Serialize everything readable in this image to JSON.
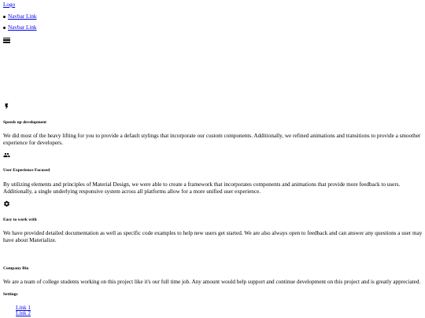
{
  "nav": {
    "logo": "Logo",
    "links": [
      "Navbar Link",
      "Navbar Link"
    ],
    "menu_icon": "menu-icon"
  },
  "features": [
    {
      "icon": "flash-icon",
      "title": "Speeds up development",
      "text": "We did most of the heavy lifting for you to provide a default stylings that incorporate our custom components. Additionally, we refined animations and transitions to provide a smoother experience for developers."
    },
    {
      "icon": "group-icon",
      "title": "User Experience Focused",
      "text": "By utilizing elements and principles of Material Design, we were able to create a framework that incorporates components and animations that provide more feedback to users. Additionally, a single underlying responsive system across all platforms allow for a more unified user experience."
    },
    {
      "icon": "settings-icon",
      "title": "Easy to work with",
      "text": "We have provided detailed documentation as well as specific code examples to help new users get started. We are also always open to feedback and can answer any questions a user may have about Materialize."
    }
  ],
  "footer": {
    "bio_title": "Company Bio",
    "bio_text": "We are a team of college students working on this project like it's our full time job. Any amount would help support and continue development on this project and is greatly appreciated.",
    "settings_title": "Settings",
    "links": [
      "Link 1",
      "Link 2"
    ]
  }
}
